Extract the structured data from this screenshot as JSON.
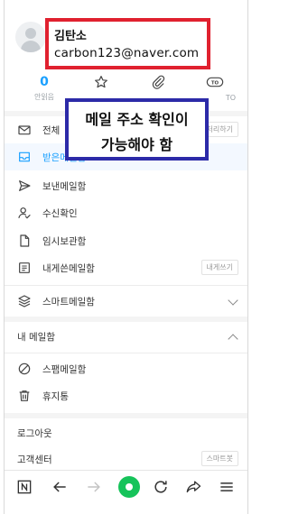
{
  "overlay": {
    "name": "김탄소",
    "email": "carbon123@naver.com",
    "note_line1": "메일 주소 확인이",
    "note_line2": "가능해야 함"
  },
  "quick": {
    "unread_count": "0",
    "unread_label": "안읽음",
    "tome_label": "TO"
  },
  "menu": {
    "all_mail": "전체",
    "all_action": "읽음처리하기",
    "inbox": "받은메일함",
    "sent": "보낸메일함",
    "receipt": "수신확인",
    "drafts": "임시보관함",
    "self_mail": "내게쓴메일함",
    "self_action": "내게쓰기",
    "smart": "스마트메일함",
    "my_mailbox": "내 메일함",
    "spam": "스팸메일함",
    "trash": "휴지통",
    "logout": "로그아웃",
    "support": "고객센터",
    "support_action": "스마트봇"
  },
  "bottom_icons": [
    "naver-n-icon",
    "back-arrow-icon",
    "forward-arrow-icon",
    "home-icon",
    "refresh-icon",
    "share-icon",
    "menu-icon"
  ]
}
